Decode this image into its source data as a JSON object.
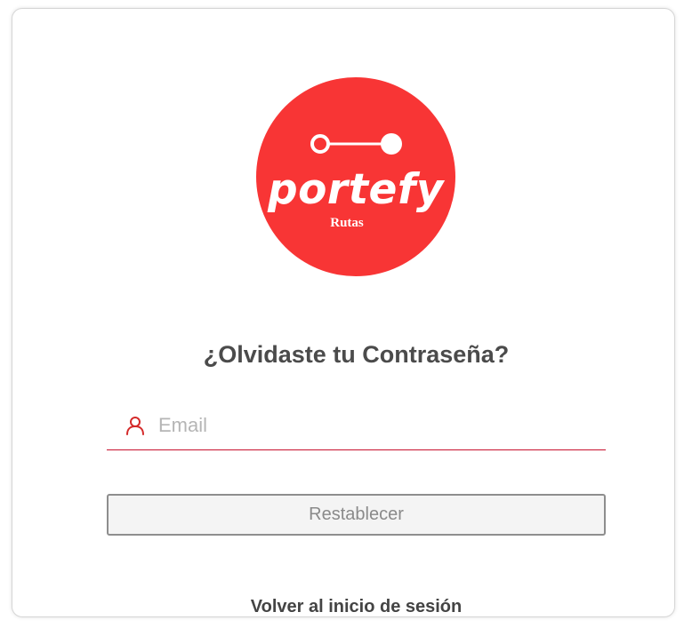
{
  "logo": {
    "brand": "portefy",
    "subtitle": "Rutas",
    "circle_color": "#f83535"
  },
  "form": {
    "title": "¿Olvidaste tu Contraseña?",
    "email": {
      "icon": "user-icon",
      "placeholder": "Email",
      "value": "",
      "underline_color": "#c8102e"
    },
    "submit_label": "Restablecer",
    "back_link_label": "Volver al inicio de sesión"
  }
}
